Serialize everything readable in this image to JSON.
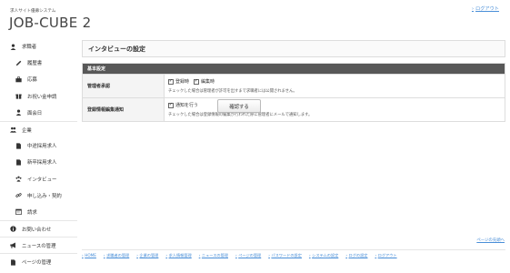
{
  "header": {
    "system_name": "求人サイト優募システム",
    "app_title": "JOB-CUBE 2",
    "logout": "ログアウト"
  },
  "sidebar": {
    "items": [
      {
        "label": "求職者",
        "icon": "person-icon"
      },
      {
        "label": "履歴書",
        "icon": "pencil-icon"
      },
      {
        "label": "応募",
        "icon": "briefcase-icon"
      },
      {
        "label": "お祝い金申請",
        "icon": "gift-icon"
      },
      {
        "label": "面会日",
        "icon": "person-icon"
      },
      {
        "label": "企業",
        "icon": "people-icon"
      },
      {
        "label": "中途採用求人",
        "icon": "document-icon"
      },
      {
        "label": "新卒採用求人",
        "icon": "document-icon"
      },
      {
        "label": "インタビュー",
        "icon": "users-icon"
      },
      {
        "label": "申し込み・契約",
        "icon": "link-icon"
      },
      {
        "label": "請求",
        "icon": "calendar-icon"
      },
      {
        "label": "お問い合わせ",
        "icon": "info-icon"
      },
      {
        "label": "ニュースの管理",
        "icon": "megaphone-icon"
      },
      {
        "label": "ページの管理",
        "icon": "page-icon"
      }
    ]
  },
  "main": {
    "title": "インタビューの設定",
    "section_title": "基本設定",
    "rows": [
      {
        "label": "管理者承認",
        "options": [
          "登録時",
          "編集時"
        ],
        "help": "チェックした場合は管理者が許可を出すまで求職者には公開されません。"
      },
      {
        "label": "登録情報編集通知",
        "options": [
          "通知を行う"
        ],
        "help": "チェックした場合は登録情報の編集が行われた際に管理者にメールで通知します。"
      }
    ],
    "confirm_button": "確認する"
  },
  "footer": {
    "pagetop": "ページの先頭へ",
    "nav": [
      "HOME",
      "求職者の管理",
      "企業の管理",
      "求人情報管理",
      "ニュースの管理",
      "ページの管理",
      "パスワードの設定",
      "システムの設定",
      "ログの設定",
      "ログアウト"
    ]
  },
  "colors": {
    "link": "#4a8fd8",
    "section_head_bg": "#585858",
    "label_bg": "#f4f4f4"
  }
}
